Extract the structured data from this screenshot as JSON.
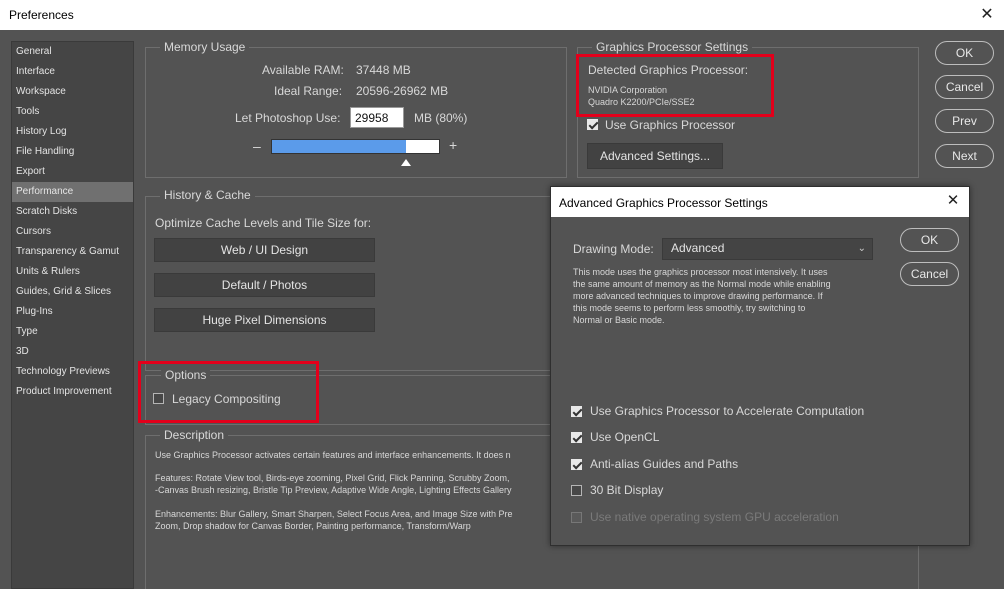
{
  "window": {
    "title": "Preferences",
    "close_glyph": "✕"
  },
  "sidebar": {
    "items": [
      {
        "label": "General"
      },
      {
        "label": "Interface"
      },
      {
        "label": "Workspace"
      },
      {
        "label": "Tools"
      },
      {
        "label": "History Log"
      },
      {
        "label": "File Handling"
      },
      {
        "label": "Export"
      },
      {
        "label": "Performance",
        "active": true
      },
      {
        "label": "Scratch Disks"
      },
      {
        "label": "Cursors"
      },
      {
        "label": "Transparency & Gamut"
      },
      {
        "label": "Units & Rulers"
      },
      {
        "label": "Guides, Grid & Slices"
      },
      {
        "label": "Plug-Ins"
      },
      {
        "label": "Type"
      },
      {
        "label": "3D"
      },
      {
        "label": "Technology Previews"
      },
      {
        "label": "Product Improvement"
      }
    ]
  },
  "memory": {
    "title": "Memory Usage",
    "available_label": "Available RAM:",
    "available_value": "37448 MB",
    "ideal_label": "Ideal Range:",
    "ideal_value": "20596-26962 MB",
    "let_label": "Let Photoshop Use:",
    "let_value": "29958",
    "let_unit": "MB (80%)",
    "minus": "–",
    "plus": "+",
    "slider_fraction": 0.8,
    "slider_color": "#5b9bea"
  },
  "gpu": {
    "title": "Graphics Processor Settings",
    "detected_label": "Detected Graphics Processor:",
    "vendor": "NVIDIA Corporation",
    "model": "Quadro K2200/PCIe/SSE2",
    "use_label": "Use Graphics Processor",
    "use_checked": true,
    "advanced_button": "Advanced Settings..."
  },
  "actions": {
    "ok": "OK",
    "cancel": "Cancel",
    "prev": "Prev",
    "next": "Next"
  },
  "history": {
    "title": "History & Cache",
    "optimize_label": "Optimize Cache Levels and Tile Size for:",
    "btn_web": "Web / UI Design",
    "btn_default": "Default / Photos",
    "btn_huge": "Huge Pixel Dimensions"
  },
  "options": {
    "title": "Options",
    "legacy_label": "Legacy Compositing",
    "legacy_checked": false
  },
  "description": {
    "title": "Description",
    "line1": "Use Graphics Processor activates certain features and interface enhancements. It does n",
    "line2": "Features: Rotate View tool, Birds-eye zooming, Pixel Grid, Flick Panning, Scrubby Zoom,",
    "line3": "-Canvas Brush resizing, Bristle Tip Preview, Adaptive Wide Angle, Lighting Effects Gallery",
    "line4": "Enhancements: Blur Gallery, Smart Sharpen, Select Focus Area, and Image Size with Pre",
    "line5": "Zoom, Drop shadow for Canvas Border, Painting performance, Transform/Warp"
  },
  "dialog": {
    "title": "Advanced Graphics Processor Settings",
    "close_glyph": "✕",
    "drawing_mode_label": "Drawing Mode:",
    "drawing_mode_value": "Advanced",
    "chevron": "⌄",
    "desc1": "This mode uses the graphics processor most intensively.  It uses",
    "desc2": "the same amount of memory as the Normal mode while enabling",
    "desc3": "more advanced techniques to improve drawing performance.  If",
    "desc4": "this mode seems to perform less smoothly, try switching to",
    "desc5": "Normal or Basic mode.",
    "ok": "OK",
    "cancel": "Cancel",
    "opt_accel": "Use Graphics Processor to Accelerate Computation",
    "opt_opencl": "Use OpenCL",
    "opt_antialias": "Anti-alias Guides and Paths",
    "opt_30bit": "30 Bit Display",
    "opt_native": "Use native operating system GPU acceleration",
    "checked_accel": true,
    "checked_opencl": true,
    "checked_antialias": true,
    "checked_30bit": false,
    "native_disabled": true
  },
  "colors": {
    "highlight_red": "#e3001b",
    "panel": "#535353"
  }
}
